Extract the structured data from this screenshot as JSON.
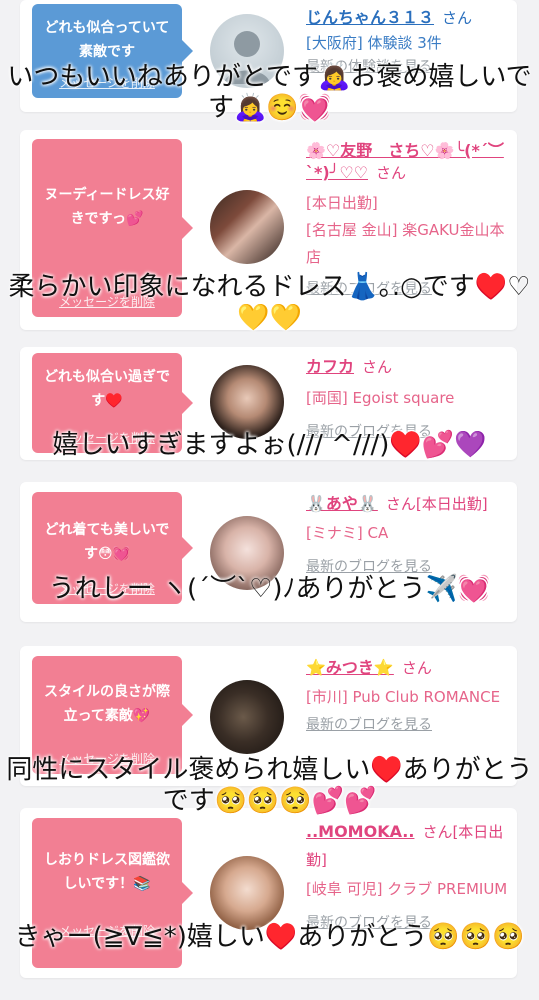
{
  "entries": [
    {
      "message": "どれも似合っていて素敵です",
      "delete_label": "メッセージを削除",
      "bubble_color": "#5b9ad6",
      "name": "じんちゃん３１３",
      "san": "さん",
      "details": [
        "[大阪府] 体験談 3件"
      ],
      "blog_link": "最新の体験談を見る",
      "caption": "いつもいいねありがとです🙇‍♀️お褒め嬉しいです🙇‍♀️☺️💓"
    },
    {
      "message": "ヌーディードレス好きですっ💕",
      "delete_label": "メッセージを削除",
      "bubble_color": "#f27f93",
      "name": "🌸♡友野　さち♡🌸╰(*´︶`*)╯♡♡",
      "san": "さん",
      "details": [
        "[本日出勤]",
        "[名古屋 金山] 楽GAKU金山本店"
      ],
      "blog_link": "最新のブログを見る",
      "caption": "柔らかい印象になれるドレス👗｡.○です♥️♡💛💛"
    },
    {
      "message": "どれも似合い過ぎです♥️",
      "delete_label": "メッセージを削除",
      "bubble_color": "#f27f93",
      "name": "カフカ",
      "san": "さん",
      "details": [
        "[両国] Egoist square"
      ],
      "blog_link": "最新のブログを見る",
      "caption": "嬉しいすぎますよぉ(/// ^///)♥️💕💜"
    },
    {
      "message": "どれ着ても美しいです😳💓",
      "delete_label": "メッセージを削除",
      "bubble_color": "#f27f93",
      "name": "🐰あや🐰",
      "san": "さん[本日出勤]",
      "details": [
        "[ミナミ] CA"
      ],
      "blog_link": "最新のブログを見る",
      "caption": "うれしー ヽ(´︶`♡)ﾉありがとう✈️💓"
    },
    {
      "message": "スタイルの良さが際立って素敵💖",
      "delete_label": "メッセージを削除",
      "bubble_color": "#f27f93",
      "name": "⭐みつき⭐",
      "san": "さん",
      "details": [
        "[市川] Pub Club ROMANCE"
      ],
      "blog_link": "最新のブログを見る",
      "caption": "同性にスタイル褒められ嬉しい♥️ありがとうです🥺🥺🥺💕💕"
    },
    {
      "message": "しおりドレス図鑑欲しいです！📚",
      "delete_label": "メッセージを削除",
      "bubble_color": "#f27f93",
      "name": "..MOMOKA..",
      "san": "さん[本日出勤]",
      "details": [
        "[岐阜 可児] クラブ PREMIUM"
      ],
      "blog_link": "最新のブログを見る",
      "caption": "きゃー(≧∇≦*)嬉しい♥️ありがとう🥺🥺🥺"
    }
  ]
}
